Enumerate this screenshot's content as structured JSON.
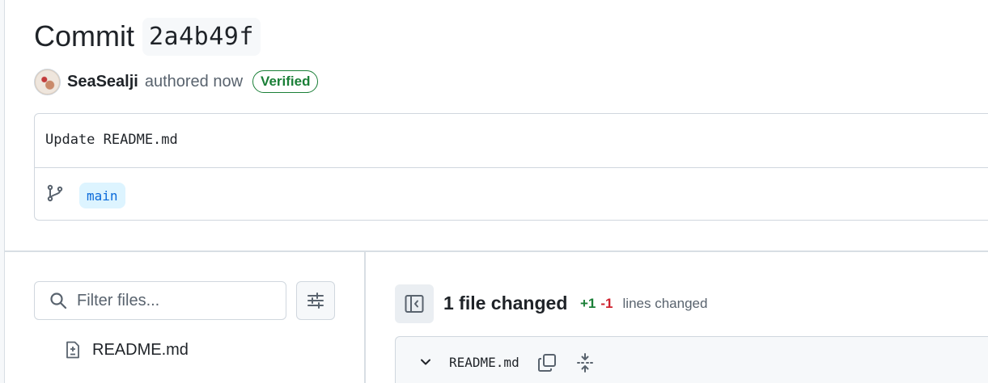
{
  "header": {
    "title": "Commit",
    "sha": "2a4b49f"
  },
  "author": {
    "name": "SeaSealji",
    "action": "authored now",
    "verified_label": "Verified"
  },
  "commit": {
    "message": "Update README.md",
    "branch": "main"
  },
  "file_filter": {
    "placeholder": "Filter files..."
  },
  "file_tree": {
    "items": [
      {
        "label": "README.md",
        "icon": "file-diff-icon"
      }
    ]
  },
  "summary": {
    "files_changed": "1 file changed",
    "additions": "+1",
    "deletions": "-1",
    "lines_changed_label": "lines changed"
  },
  "file_header": {
    "filename": "README.md"
  },
  "colors": {
    "accent": "#0969da",
    "verified": "#1a7f37",
    "addition": "#1a7f37",
    "deletion": "#cf222e",
    "branch_bg": "#ddf4ff"
  }
}
